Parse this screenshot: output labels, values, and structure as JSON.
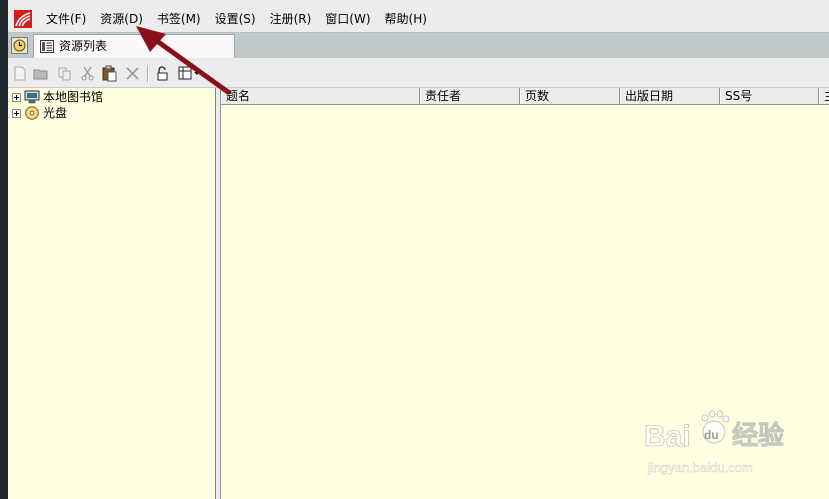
{
  "menu": {
    "items": [
      "文件(F)",
      "资源(D)",
      "书签(M)",
      "设置(S)",
      "注册(R)",
      "窗口(W)",
      "帮助(H)"
    ]
  },
  "tabs": [
    {
      "label": "资源列表",
      "icon": "list-icon"
    }
  ],
  "toolbar": {
    "buttons": [
      "new-icon",
      "folder-icon",
      "copy-icon",
      "cut-icon",
      "paste-icon",
      "delete-icon",
      "lock-icon",
      "view-icon"
    ]
  },
  "tree": {
    "nodes": [
      {
        "label": "本地图书馆",
        "icon": "computer-icon"
      },
      {
        "label": "光盘",
        "icon": "disc-icon"
      }
    ]
  },
  "list": {
    "columns": [
      "题名",
      "责任者",
      "页数",
      "出版日期",
      "SS号",
      "主"
    ]
  },
  "watermark": {
    "brand": "Bai",
    "paw": "du",
    "service": "经验",
    "url": "jingyan.baidu.com"
  },
  "colors": {
    "pane_background": "#ffffe2",
    "logo_red": "#d51d1d",
    "arrow": "#8b0f1a",
    "chrome": "#ececec",
    "tabstrip": "#c0c9cc"
  }
}
